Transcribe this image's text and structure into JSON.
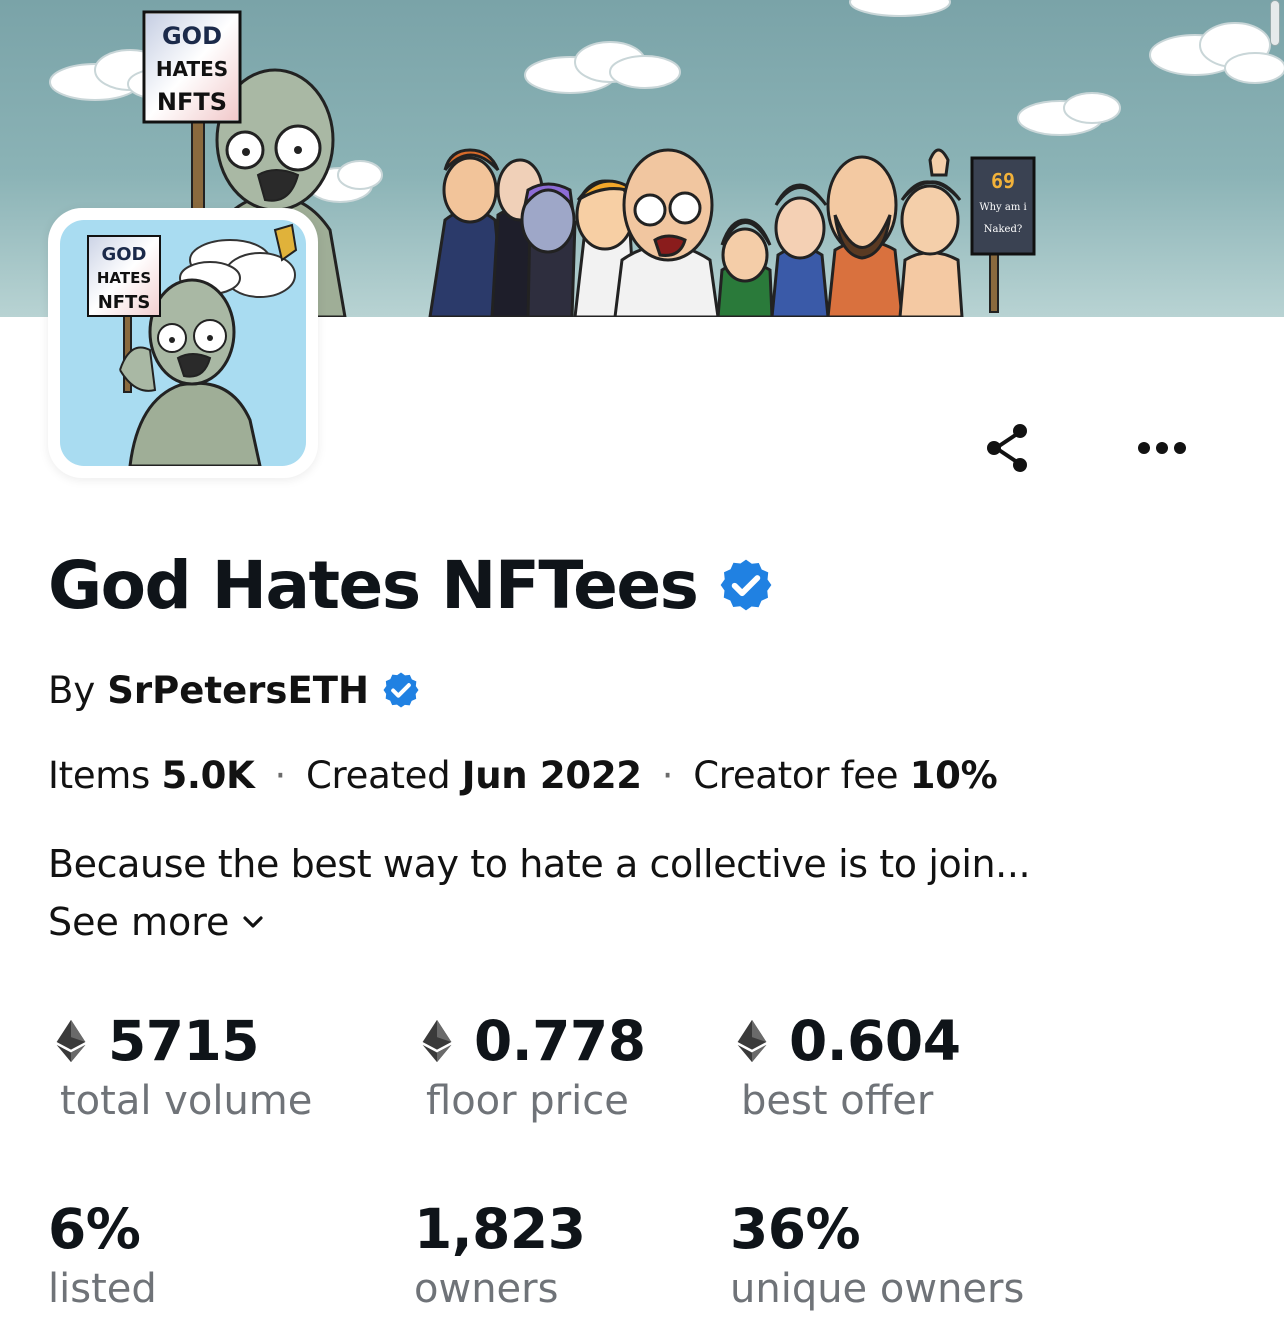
{
  "banner": {
    "sign_left": [
      "GOD",
      "HATES",
      "NFTS"
    ],
    "sign_right": [
      "69",
      "Why am i",
      "Naked?"
    ]
  },
  "avatar": {
    "sign": [
      "GOD",
      "HATES",
      "NFTS"
    ]
  },
  "actions": {
    "share_icon": "share-icon",
    "more_icon": "more-horizontal-icon"
  },
  "collection": {
    "title": "God Hates NFTees",
    "verified_icon": "verified-badge-icon",
    "by_label": "By",
    "creator": "SrPetersETH",
    "meta": {
      "items_label": "Items",
      "items_value": "5.0K",
      "created_label": "Created",
      "created_value": "Jun 2022",
      "fee_label": "Creator fee",
      "fee_value": "10%",
      "separator": "·"
    },
    "description": "Because the best way to hate a collective is to join...",
    "see_more": "See more"
  },
  "stats": [
    {
      "value": "5715",
      "label": "total volume",
      "icon": "ethereum-icon"
    },
    {
      "value": "0.778",
      "label": "floor price",
      "icon": "ethereum-icon"
    },
    {
      "value": "0.604",
      "label": "best offer",
      "icon": "ethereum-icon"
    },
    {
      "value": "6%",
      "label": "listed"
    },
    {
      "value": "1,823",
      "label": "owners"
    },
    {
      "value": "36%",
      "label": "unique owners"
    }
  ],
  "colors": {
    "verified_blue": "#2081e2",
    "text_primary": "#121212",
    "text_secondary": "#6f7378",
    "banner_sky": "#7aa3a8",
    "avatar_sky": "#a9dcf1"
  }
}
